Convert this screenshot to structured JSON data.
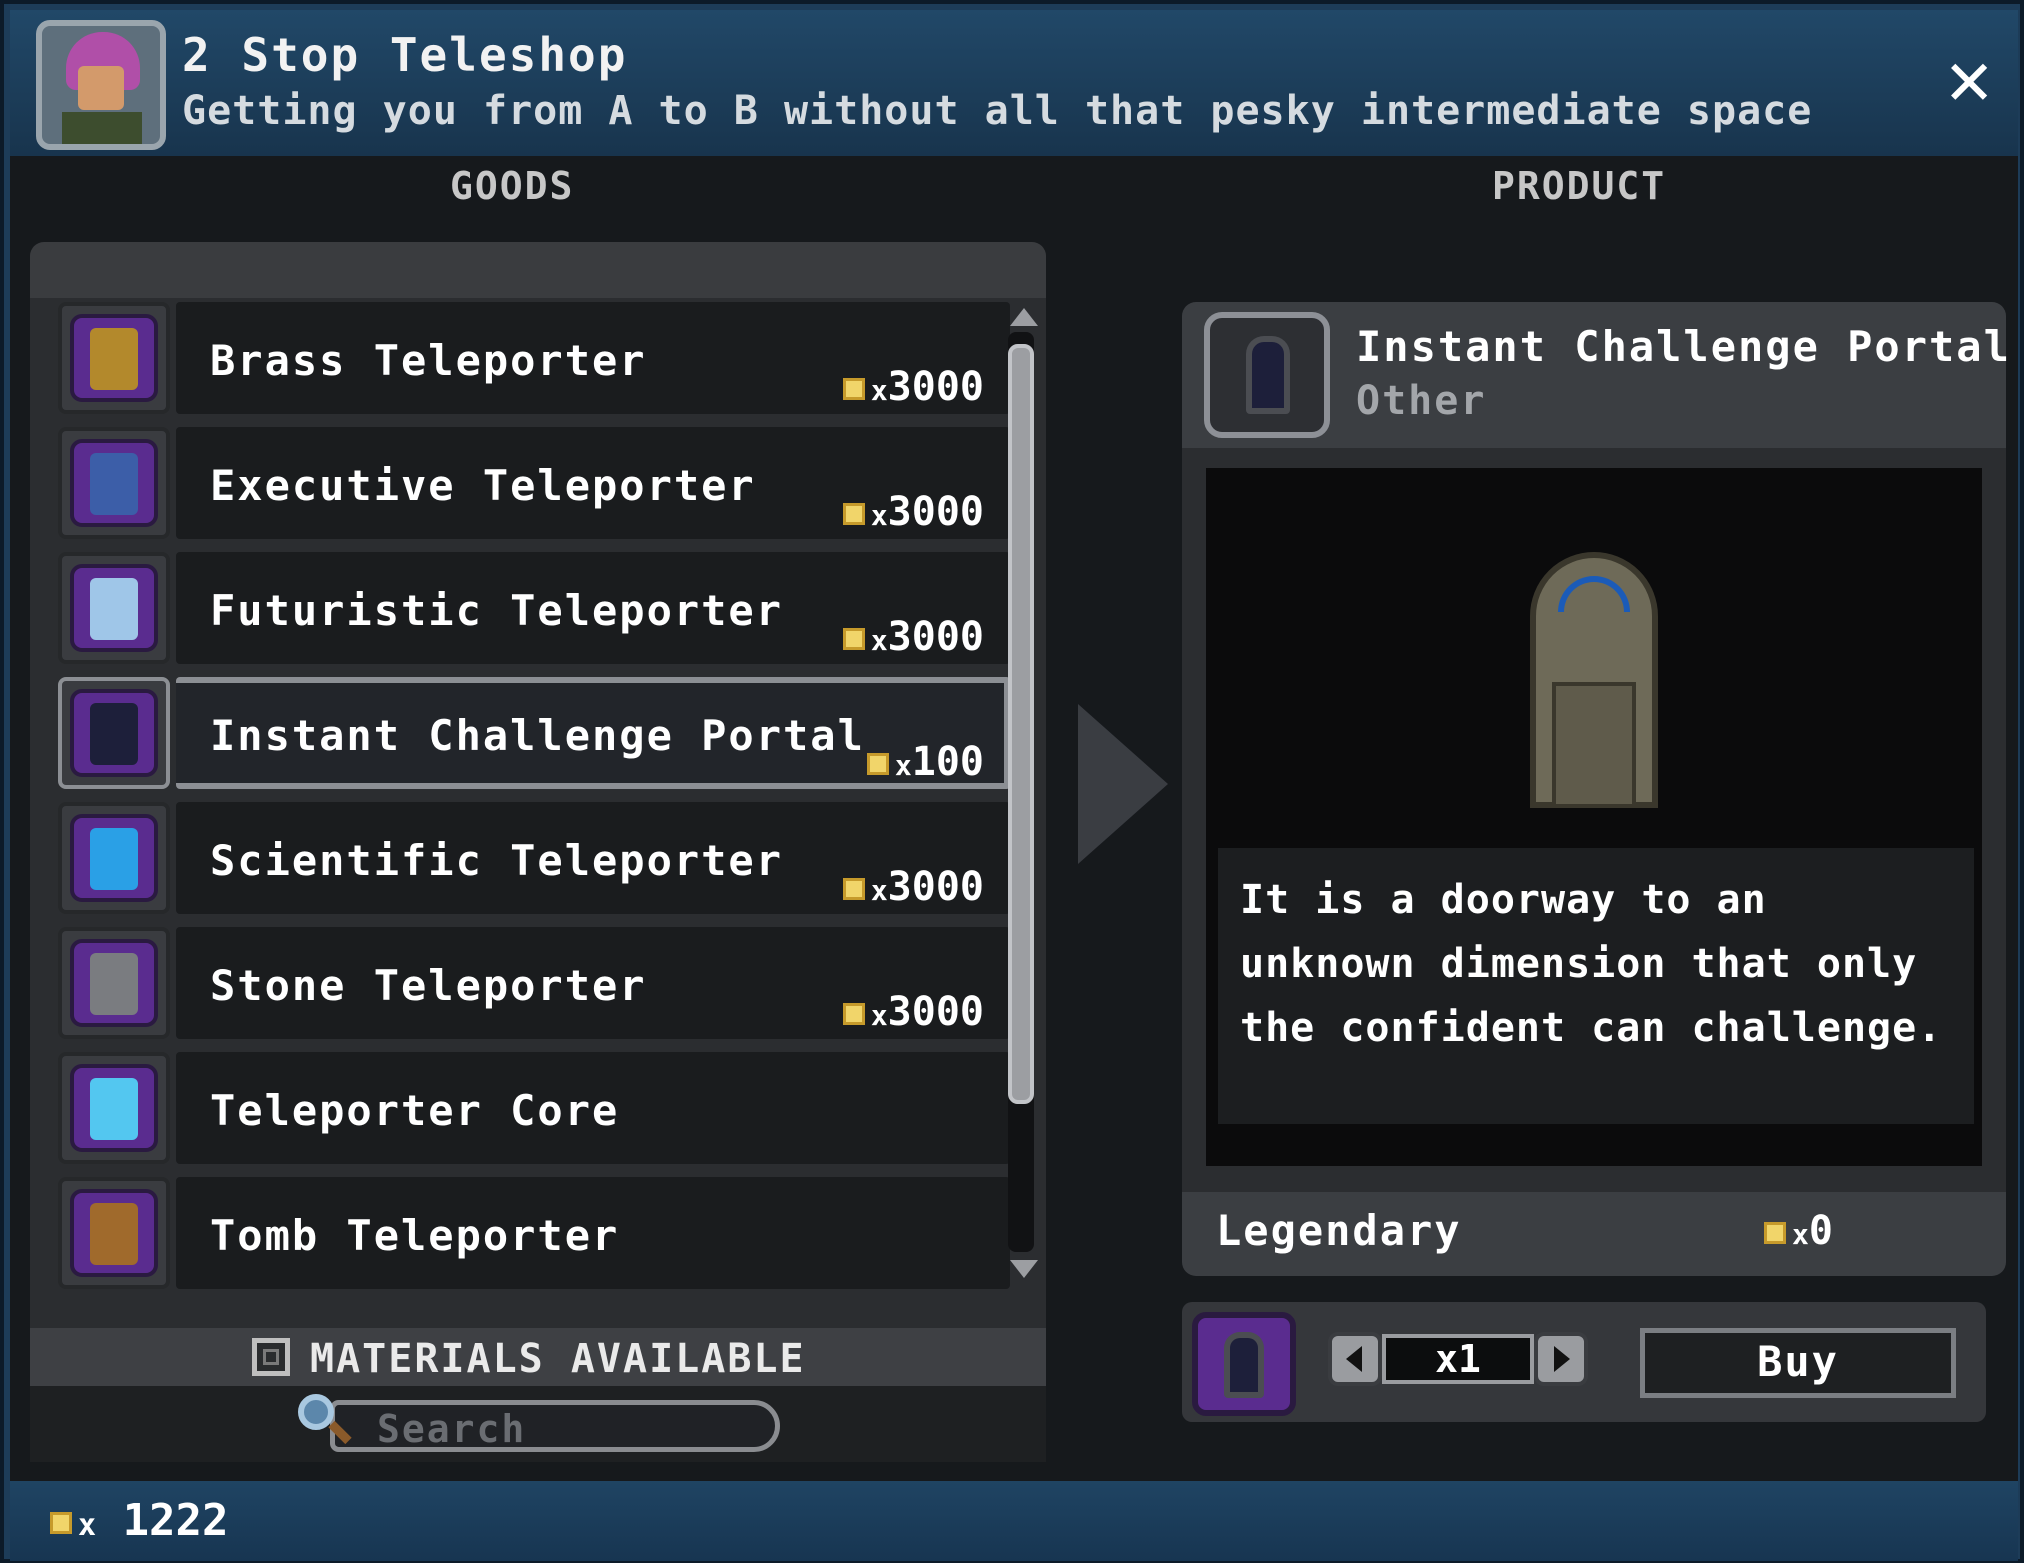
{
  "shop": {
    "title": "2 Stop Teleshop",
    "subtitle": "Getting you from A to B without all that pesky intermediate space",
    "close_label": "✕"
  },
  "columns": {
    "goods": "GOODS",
    "product": "PRODUCT"
  },
  "goods": [
    {
      "name": "Brass Teleporter",
      "price": "3000",
      "icon": "brass-teleporter-icon",
      "color": "#b3892c"
    },
    {
      "name": "Executive Teleporter",
      "price": "3000",
      "icon": "executive-teleporter-icon",
      "color": "#3c5ea8"
    },
    {
      "name": "Futuristic Teleporter",
      "price": "3000",
      "icon": "futuristic-teleporter-icon",
      "color": "#9fc6e8"
    },
    {
      "name": "Instant Challenge Portal",
      "price": "100",
      "icon": "instant-challenge-portal-icon",
      "color": "#1d1f3a"
    },
    {
      "name": "Scientific Teleporter",
      "price": "3000",
      "icon": "scientific-teleporter-icon",
      "color": "#2aa0e6"
    },
    {
      "name": "Stone Teleporter",
      "price": "3000",
      "icon": "stone-teleporter-icon",
      "color": "#7a7c80"
    },
    {
      "name": "Teleporter Core",
      "price": "",
      "icon": "teleporter-core-icon",
      "color": "#53c7f0"
    },
    {
      "name": "Tomb Teleporter",
      "price": "",
      "icon": "tomb-teleporter-icon",
      "color": "#a06a2c"
    }
  ],
  "selected_index": 3,
  "filters": {
    "materials_label": "MATERIALS AVAILABLE",
    "materials_checked": false,
    "search_placeholder": "Search"
  },
  "product": {
    "name": "Instant Challenge Portal",
    "category": "Other",
    "description": "It is a doorway to an unknown dimension that only the confident can challenge.",
    "rarity": "Legendary",
    "cost": "0",
    "quantity": "x1",
    "buy_label": "Buy"
  },
  "player": {
    "pixels": "1222"
  },
  "colors": {
    "accent_purple": "#5a2c8f",
    "coin": "#f1d56a",
    "header": "#1d3c58"
  }
}
